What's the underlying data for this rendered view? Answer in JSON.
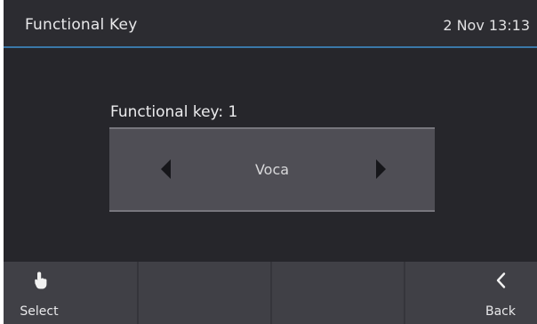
{
  "header": {
    "title": "Functional Key",
    "datetime": "2 Nov 13:13"
  },
  "main": {
    "label": "Functional key: 1",
    "selector": {
      "value": "Voca",
      "prev_icon": "left-triangle-arrow",
      "next_icon": "right-triangle-arrow"
    }
  },
  "softkeys": [
    {
      "label": "Select",
      "icon": "hand-pointer-icon"
    },
    {
      "label": "",
      "icon": ""
    },
    {
      "label": "",
      "icon": ""
    },
    {
      "label": "Back",
      "icon": "chevron-left-icon"
    }
  ],
  "colors": {
    "background": "#26262b",
    "header_line": "#3a78a8",
    "selector_bg": "#4f4e55",
    "softkey_bg": "#404046"
  }
}
